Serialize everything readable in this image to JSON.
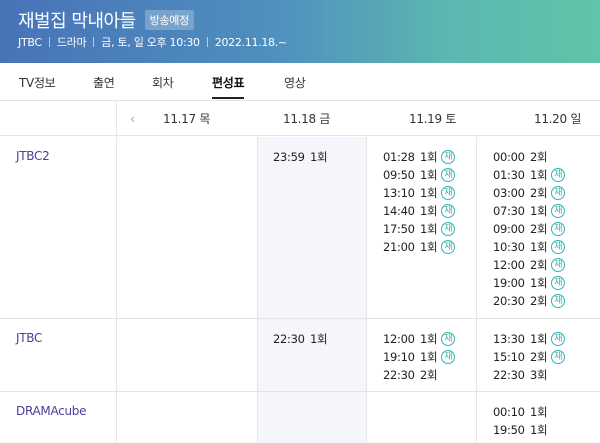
{
  "header": {
    "title": "재벌집 막내아들",
    "badge": "방송예정",
    "meta": [
      "JTBC",
      "드라마",
      "금, 토, 일 오후 10:30",
      "2022.11.18.~"
    ]
  },
  "tabs": [
    {
      "label": "TV정보"
    },
    {
      "label": "출연"
    },
    {
      "label": "회차"
    },
    {
      "label": "편성표"
    },
    {
      "label": "영상"
    }
  ],
  "schedule": {
    "dates": [
      "11.17 목",
      "11.18 금",
      "11.19 토",
      "11.20 일"
    ],
    "rerun_label": "재",
    "rows": [
      {
        "channel": "JTBC2",
        "days": [
          [],
          [
            {
              "time": "23:59",
              "ep": "1회",
              "rerun": false
            }
          ],
          [
            {
              "time": "01:28",
              "ep": "1회",
              "rerun": true
            },
            {
              "time": "09:50",
              "ep": "1회",
              "rerun": true
            },
            {
              "time": "13:10",
              "ep": "1회",
              "rerun": true
            },
            {
              "time": "14:40",
              "ep": "1회",
              "rerun": true
            },
            {
              "time": "17:50",
              "ep": "1회",
              "rerun": true
            },
            {
              "time": "21:00",
              "ep": "1회",
              "rerun": true
            }
          ],
          [
            {
              "time": "00:00",
              "ep": "2회",
              "rerun": false
            },
            {
              "time": "01:30",
              "ep": "1회",
              "rerun": true
            },
            {
              "time": "03:00",
              "ep": "2회",
              "rerun": true
            },
            {
              "time": "07:30",
              "ep": "1회",
              "rerun": true
            },
            {
              "time": "09:00",
              "ep": "2회",
              "rerun": true
            },
            {
              "time": "10:30",
              "ep": "1회",
              "rerun": true
            },
            {
              "time": "12:00",
              "ep": "2회",
              "rerun": true
            },
            {
              "time": "19:00",
              "ep": "1회",
              "rerun": true
            },
            {
              "time": "20:30",
              "ep": "2회",
              "rerun": true
            }
          ]
        ]
      },
      {
        "channel": "JTBC",
        "days": [
          [],
          [
            {
              "time": "22:30",
              "ep": "1회",
              "rerun": false
            }
          ],
          [
            {
              "time": "12:00",
              "ep": "1회",
              "rerun": true
            },
            {
              "time": "19:10",
              "ep": "1회",
              "rerun": true
            },
            {
              "time": "22:30",
              "ep": "2회",
              "rerun": false
            }
          ],
          [
            {
              "time": "13:30",
              "ep": "1회",
              "rerun": true
            },
            {
              "time": "15:10",
              "ep": "2회",
              "rerun": true
            },
            {
              "time": "22:30",
              "ep": "3회",
              "rerun": false
            }
          ]
        ]
      },
      {
        "channel": "DRAMAcube",
        "days": [
          [],
          [],
          [],
          [
            {
              "time": "00:10",
              "ep": "1회",
              "rerun": false
            },
            {
              "time": "19:50",
              "ep": "1회",
              "rerun": false
            }
          ]
        ]
      }
    ]
  },
  "colors": {
    "accent_teal": "#2fb5ad",
    "channel_text": "#4a3f9a",
    "today_column": "#f4f6fb"
  }
}
